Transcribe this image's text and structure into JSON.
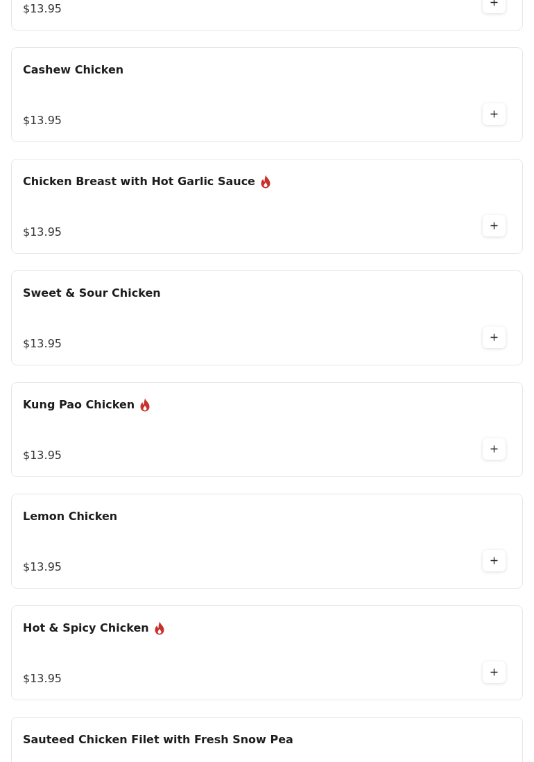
{
  "menu_items": [
    {
      "price": "$13.95"
    },
    {
      "name": "Cashew Chicken",
      "price": "$13.95",
      "spicy": false
    },
    {
      "name": "Chicken Breast with Hot Garlic Sauce",
      "price": "$13.95",
      "spicy": true
    },
    {
      "name": "Sweet & Sour Chicken",
      "price": "$13.95",
      "spicy": false
    },
    {
      "name": "Kung Pao Chicken",
      "price": "$13.95",
      "spicy": true
    },
    {
      "name": "Lemon Chicken",
      "price": "$13.95",
      "spicy": false
    },
    {
      "name": "Hot & Spicy Chicken",
      "price": "$13.95",
      "spicy": true
    },
    {
      "name": "Sauteed Chicken Filet with Fresh Snow Pea",
      "spicy": false
    }
  ]
}
